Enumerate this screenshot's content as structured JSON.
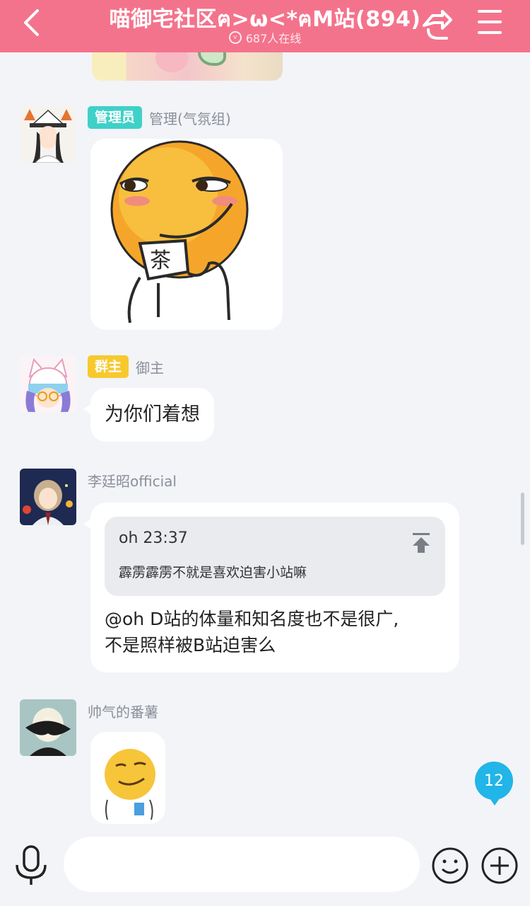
{
  "header": {
    "title": "喵御宅社区ฅ>ω<*ฅM站(894)",
    "online": "687人在线",
    "back_icon": "chevron-left-icon",
    "share_icon": "share-icon",
    "menu_icon": "menu-icon",
    "background": "#f4738c"
  },
  "messages": [
    {
      "badge": "管理员",
      "username": "管理(气氛组)",
      "content_type": "sticker",
      "sticker_text": "茶"
    },
    {
      "badge": "群主",
      "username": "御主",
      "content_type": "text",
      "text": "为你们着想"
    },
    {
      "username": "李廷昭official",
      "content_type": "reply",
      "quote": {
        "name": "oh 23:37",
        "text": "霹雳霹雳不就是喜欢迫害小站嘛"
      },
      "text_line1": "@oh D站的体量和知名度也不是很广,",
      "text_line2": "不是照样被B站迫害么"
    },
    {
      "username": "帅气的番薯",
      "content_type": "sticker"
    }
  ],
  "unread_count": "12",
  "input": {
    "placeholder": "",
    "value": ""
  },
  "colors": {
    "admin_badge": "#3ed1c8",
    "owner_badge": "#f7c92e",
    "unread": "#22b5e8"
  }
}
